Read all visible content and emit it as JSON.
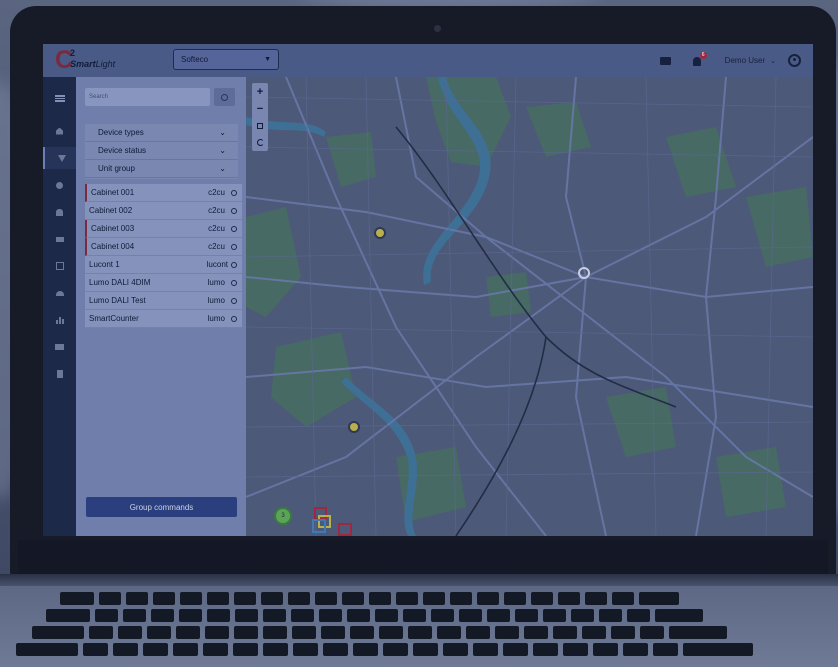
{
  "header": {
    "logo_number": "2",
    "logo_brand_a": "Smart",
    "logo_brand_b": "Light",
    "org_select_value": "Softeco",
    "user_name": "Demo User",
    "notification_count": "6"
  },
  "panel": {
    "search_placeholder": "Search",
    "filters": [
      {
        "label": "Device types"
      },
      {
        "label": "Device status"
      },
      {
        "label": "Unit group"
      }
    ],
    "devices": [
      {
        "name": "Cabinet 001",
        "type": "c2cu"
      },
      {
        "name": "Cabinet 002",
        "type": "c2cu"
      },
      {
        "name": "Cabinet 003",
        "type": "c2cu"
      },
      {
        "name": "Cabinet 004",
        "type": "c2cu"
      },
      {
        "name": "Lucont 1",
        "type": "lucont"
      },
      {
        "name": "Lumo DALI 4DIM",
        "type": "lumo"
      },
      {
        "name": "Lumo DALI Test",
        "type": "lumo"
      },
      {
        "name": "SmartCounter",
        "type": "lumo"
      }
    ],
    "group_commands_label": "Group commands"
  },
  "map": {
    "zoom_in": "+",
    "zoom_out": "−",
    "cluster_count": "3"
  },
  "colors": {
    "accent": "#2b3f7f",
    "brand": "#7a2a3d",
    "marker_yellow": "#b8b04a",
    "marker_green": "#5aa35a"
  }
}
